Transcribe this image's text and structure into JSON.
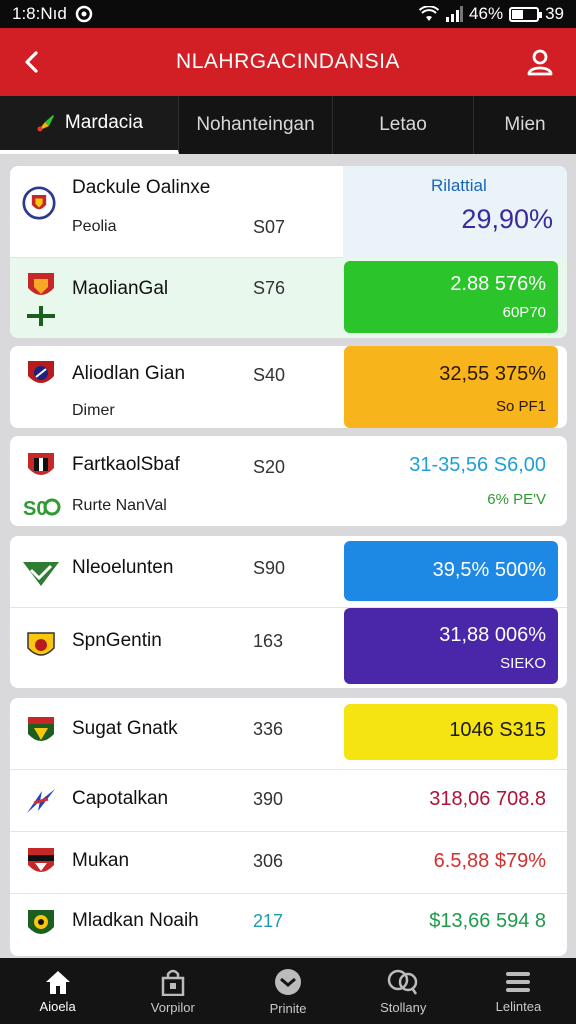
{
  "status_bar": {
    "time": "1:8:Nıd",
    "battery": "46%",
    "extra": "39",
    "battery_level": 0.46
  },
  "app_bar": {
    "title": "NLAHRGACINDANSIA"
  },
  "tabs": [
    {
      "label": "Mardacia",
      "active": true
    },
    {
      "label": "Nohanteingan",
      "active": false
    },
    {
      "label": "Letao",
      "active": false
    },
    {
      "label": "Mien",
      "active": false
    }
  ],
  "featured": {
    "name": "Dackule Oalinxe",
    "sub": "Peolia",
    "pts": "S07",
    "badge_label": "Rilattial",
    "badge_value": "29,90%"
  },
  "rows": [
    {
      "name": "MaolianGal",
      "pts": "S76",
      "badge_main": "2.88 576%",
      "badge_small": "60P70",
      "badge_color": "#2bc42b"
    },
    {
      "name": "Aliodlan Gian",
      "sub": "Dimer",
      "pts": "S40",
      "badge_main": "32,55 375%",
      "badge_small": "So PF1",
      "badge_color": "#f7b51b"
    },
    {
      "name": "FartkaolSbaf",
      "sub": "Rurte NanVal",
      "pts": "S20",
      "badge_main": "31-35,56 S6,00",
      "badge_small": "6% PE'V"
    },
    {
      "name": "Nleoelunten",
      "pts": "S90",
      "badge_main": "39,5% 500%",
      "badge_color": "#1e88e5"
    },
    {
      "name": "SpnGentin",
      "pts": "163",
      "badge_main": "31,88 006%",
      "badge_small": "SIEKO",
      "badge_color": "#4a27a8"
    },
    {
      "name": "Sugat Gnatk",
      "pts": "336",
      "badge_main": "1046 S315",
      "badge_color": "#f6e412"
    },
    {
      "name": "Capotalkan",
      "pts": "390",
      "badge_main": "318,06 708.8"
    },
    {
      "name": "Mukan",
      "pts": "306",
      "badge_main": "6.5,88 $79%"
    },
    {
      "name": "Mladkan Noaih",
      "pts": "217",
      "badge_main": "$13,66 594 8"
    }
  ],
  "bottom_nav": [
    {
      "label": "Aioela",
      "icon": "home-icon",
      "active": true
    },
    {
      "label": "Vorpilor",
      "icon": "bag-icon",
      "active": false
    },
    {
      "label": "Prinite",
      "icon": "ball-icon",
      "active": false
    },
    {
      "label": "Stollany",
      "icon": "chat-icon",
      "active": false
    },
    {
      "label": "Lelintea",
      "icon": "menu-icon",
      "active": false
    }
  ],
  "colors": {
    "brand_red": "#d21f26",
    "dark": "#141414",
    "green": "#2bc42b",
    "orange": "#f7b51b",
    "blue": "#1e88e5",
    "purple": "#4a27a8",
    "yellow": "#f6e412"
  }
}
